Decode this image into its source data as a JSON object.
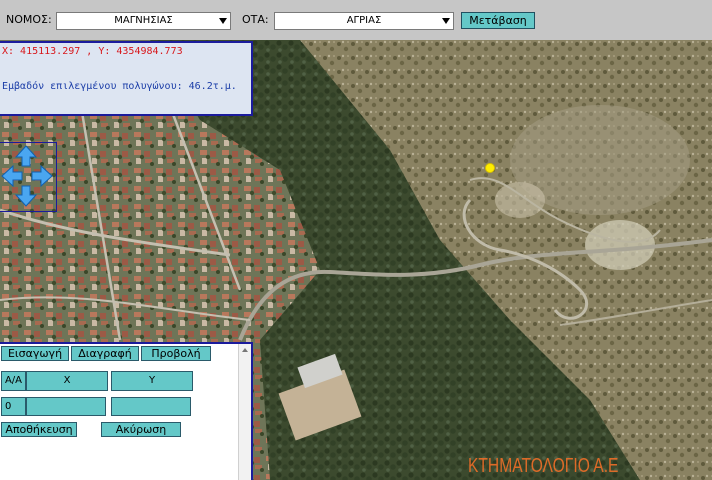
{
  "topbar": {
    "nomos_label": "ΝΟΜΟΣ:",
    "nomos_value": "ΜΑΓΝΗΣΙΑΣ",
    "ota_label": "ΟΤΑ:",
    "ota_value": "ΑΓΡΙΑΣ",
    "go_label": "Μετάβαση"
  },
  "info": {
    "coords": "X: 415113.297 , Y: 4354984.773",
    "area": "Εμβαδόν επιλεγμένου πολυγώνου: 46.2τ.μ."
  },
  "pan": {
    "icons": [
      "arrow-up-icon",
      "arrow-left-icon",
      "arrow-right-icon",
      "arrow-down-icon"
    ]
  },
  "edit": {
    "tabs": [
      "Εισαγωγή",
      "Διαγραφή",
      "Προβολή"
    ],
    "headers": [
      "A/A",
      "X",
      "Y"
    ],
    "row": {
      "aa": "0",
      "x": "",
      "y": ""
    },
    "save_label": "Αποθήκευση",
    "cancel_label": "Ακύρωση"
  },
  "logo": "ΚΤΗΜΑΤΟΛΟΓΙΟ Α.Ε",
  "colors": {
    "accent_button": "#64c8c8",
    "panel_border": "#1b1b9c",
    "coords_text": "#d8181c",
    "area_text": "#1c3ea8",
    "logo": "#ec6e28",
    "marker": "#ffee00"
  }
}
